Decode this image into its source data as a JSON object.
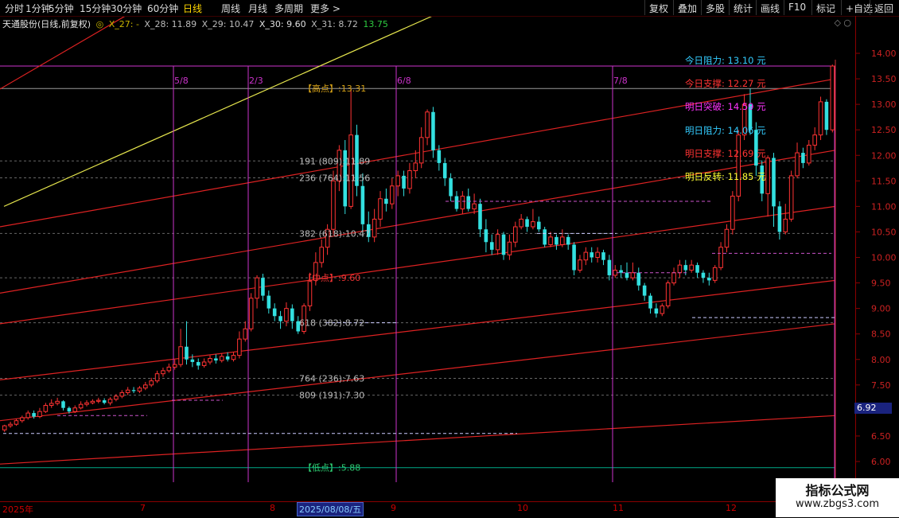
{
  "toolbar": {
    "periods": [
      "分时",
      "1分钟",
      "5分钟",
      "15分钟",
      "30分钟",
      "60分钟",
      "日线",
      "周线",
      "月线",
      "多周期",
      "更多 >"
    ],
    "active_index": 6,
    "right_buttons": [
      "复权",
      "叠加",
      "多股",
      "统计",
      "画线",
      "F10",
      "标记",
      "+自选",
      "返回"
    ]
  },
  "title": {
    "name": "天通股份(日线,前复权)",
    "dot": "◎",
    "x27": "X_27: -",
    "x28": "X_28: 11.89",
    "x29": "X_29: 10.47",
    "x30": "X_30: 9.60",
    "x31": "X_31: 8.72",
    "last": "13.75"
  },
  "corner_icons": "◇ ○",
  "y_axis": [
    "14.00",
    "13.50",
    "13.00",
    "12.50",
    "12.00",
    "11.50",
    "11.00",
    "10.50",
    "10.00",
    "9.50",
    "9.00",
    "8.50",
    "8.00",
    "7.50",
    "7.00",
    "6.50",
    "6.00"
  ],
  "current_price_tag": "6.92",
  "x_axis": {
    "labels": [
      "2025年",
      "7",
      "8",
      "9",
      "10",
      "11",
      "12"
    ],
    "selected_date": "2025/08/08/五"
  },
  "annotations": {
    "high": "【高点】:13.31",
    "mid": "【中点】:9.60",
    "low": "【低点】:5.88",
    "fib191": "191 (809):11.89",
    "fib236": "236 (764):11.56",
    "fib382": "382 (618):10.47",
    "fib618": "618 (382):8.72",
    "fib764": "764 (236):7.63",
    "fib809": "809 (191):7.30"
  },
  "cycle_labels": [
    "5/8",
    "2/3",
    "6/8",
    "7/8"
  ],
  "levels": [
    {
      "label": "今日阻力: 13.10 元",
      "color": "#33ccff"
    },
    {
      "label": "今日支撑: 12.27 元",
      "color": "#ff3333"
    },
    {
      "label": "明日突破: 14.59 元",
      "color": "#ff33ff"
    },
    {
      "label": "明日阻力: 14.06 元",
      "color": "#33ccff"
    },
    {
      "label": "明日支撑: 12.69 元",
      "color": "#ff3333"
    },
    {
      "label": "明日反转: 11.85 元",
      "color": "#ffff33"
    }
  ],
  "watermark": {
    "line1": "指标公式网",
    "line2": "www.zbgs3.com"
  },
  "colors": {
    "up": "#ff3333",
    "down": "#33e0e0",
    "axis": "#8b0000",
    "fib_line": "#666666",
    "cycle": "#cc33cc"
  },
  "chart_data": {
    "type": "candlestick",
    "y_range": [
      5.7,
      14.2
    ],
    "candles": [
      [
        6.62,
        6.7,
        6.72,
        6.58
      ],
      [
        6.7,
        6.73,
        6.78,
        6.66
      ],
      [
        6.73,
        6.8,
        6.84,
        6.7
      ],
      [
        6.8,
        6.86,
        6.9,
        6.76
      ],
      [
        6.86,
        6.95,
        7.0,
        6.82
      ],
      [
        6.95,
        6.88,
        7.0,
        6.84
      ],
      [
        6.88,
        6.98,
        7.05,
        6.85
      ],
      [
        6.98,
        7.1,
        7.15,
        6.95
      ],
      [
        7.1,
        7.14,
        7.22,
        7.05
      ],
      [
        7.14,
        7.18,
        7.25,
        7.1
      ],
      [
        7.18,
        7.05,
        7.2,
        7.0
      ],
      [
        7.05,
        6.98,
        7.08,
        6.94
      ],
      [
        6.98,
        7.05,
        7.1,
        6.95
      ],
      [
        7.05,
        7.12,
        7.18,
        7.02
      ],
      [
        7.12,
        7.15,
        7.2,
        7.08
      ],
      [
        7.15,
        7.18,
        7.22,
        7.12
      ],
      [
        7.18,
        7.2,
        7.25,
        7.14
      ],
      [
        7.2,
        7.15,
        7.24,
        7.12
      ],
      [
        7.15,
        7.22,
        7.26,
        7.1
      ],
      [
        7.22,
        7.28,
        7.32,
        7.18
      ],
      [
        7.28,
        7.35,
        7.4,
        7.24
      ],
      [
        7.35,
        7.4,
        7.46,
        7.3
      ],
      [
        7.4,
        7.38,
        7.46,
        7.34
      ],
      [
        7.38,
        7.44,
        7.48,
        7.34
      ],
      [
        7.44,
        7.5,
        7.56,
        7.4
      ],
      [
        7.5,
        7.58,
        7.64,
        7.46
      ],
      [
        7.58,
        7.72,
        7.78,
        7.54
      ],
      [
        7.72,
        7.78,
        7.84,
        7.66
      ],
      [
        7.78,
        7.85,
        7.92,
        7.74
      ],
      [
        7.85,
        7.9,
        8.0,
        7.8
      ],
      [
        7.9,
        8.25,
        8.6,
        7.85
      ],
      [
        8.25,
        8.0,
        8.75,
        7.9
      ],
      [
        8.0,
        7.95,
        8.1,
        7.85
      ],
      [
        7.95,
        7.88,
        8.02,
        7.8
      ],
      [
        7.88,
        7.95,
        8.02,
        7.84
      ],
      [
        7.95,
        8.02,
        8.08,
        7.9
      ],
      [
        8.02,
        7.98,
        8.1,
        7.92
      ],
      [
        7.98,
        8.06,
        8.12,
        7.94
      ],
      [
        8.06,
        8.0,
        8.14,
        7.96
      ],
      [
        8.0,
        8.08,
        8.14,
        7.96
      ],
      [
        8.08,
        8.4,
        8.55,
        8.02
      ],
      [
        8.4,
        8.6,
        8.75,
        8.35
      ],
      [
        8.6,
        9.2,
        9.3,
        8.55
      ],
      [
        9.2,
        9.6,
        9.65,
        9.0
      ],
      [
        9.6,
        9.25,
        9.68,
        9.15
      ],
      [
        9.25,
        9.0,
        9.35,
        8.9
      ],
      [
        9.0,
        8.85,
        9.1,
        8.75
      ],
      [
        8.85,
        8.75,
        8.95,
        8.6
      ],
      [
        8.75,
        9.0,
        9.12,
        8.65
      ],
      [
        9.0,
        8.75,
        9.08,
        8.6
      ],
      [
        8.75,
        8.55,
        8.85,
        8.5
      ],
      [
        8.55,
        9.05,
        9.1,
        8.5
      ],
      [
        9.05,
        9.55,
        9.7,
        8.95
      ],
      [
        9.55,
        9.9,
        10.1,
        9.45
      ],
      [
        9.9,
        10.2,
        10.35,
        9.8
      ],
      [
        10.2,
        10.55,
        10.65,
        10.05
      ],
      [
        10.55,
        11.5,
        11.7,
        10.45
      ],
      [
        11.5,
        12.1,
        12.2,
        11.3
      ],
      [
        12.1,
        11.0,
        12.3,
        10.85
      ],
      [
        11.0,
        12.4,
        13.31,
        10.95
      ],
      [
        12.4,
        11.4,
        12.6,
        11.2
      ],
      [
        11.4,
        10.65,
        11.65,
        10.4
      ],
      [
        10.65,
        10.4,
        10.9,
        10.3
      ],
      [
        10.4,
        10.75,
        10.95,
        10.3
      ],
      [
        10.75,
        11.15,
        11.3,
        10.6
      ],
      [
        11.15,
        11.05,
        11.35,
        10.9
      ],
      [
        11.05,
        11.4,
        11.55,
        10.95
      ],
      [
        11.4,
        11.6,
        11.7,
        11.2
      ],
      [
        11.6,
        11.35,
        11.7,
        11.2
      ],
      [
        11.35,
        11.7,
        11.85,
        11.25
      ],
      [
        11.7,
        11.85,
        12.1,
        11.55
      ],
      [
        11.85,
        12.35,
        12.55,
        11.75
      ],
      [
        12.35,
        12.85,
        12.9,
        12.2
      ],
      [
        12.85,
        12.1,
        12.95,
        11.95
      ],
      [
        12.1,
        11.85,
        12.2,
        11.7
      ],
      [
        11.85,
        11.55,
        11.95,
        11.4
      ],
      [
        11.55,
        11.2,
        11.65,
        11.1
      ],
      [
        11.2,
        10.95,
        11.3,
        10.9
      ],
      [
        10.95,
        11.2,
        11.3,
        10.85
      ],
      [
        11.2,
        10.95,
        11.35,
        10.9
      ],
      [
        10.95,
        11.05,
        11.25,
        10.85
      ],
      [
        11.05,
        10.55,
        11.15,
        10.4
      ],
      [
        10.55,
        10.3,
        10.75,
        10.1
      ],
      [
        10.3,
        10.15,
        10.45,
        10.05
      ],
      [
        10.15,
        10.45,
        10.55,
        10.05
      ],
      [
        10.45,
        10.05,
        10.5,
        9.95
      ],
      [
        10.05,
        10.3,
        10.45,
        9.95
      ],
      [
        10.3,
        10.6,
        10.7,
        10.2
      ],
      [
        10.6,
        10.75,
        10.85,
        10.55
      ],
      [
        10.75,
        10.6,
        10.8,
        10.5
      ],
      [
        10.6,
        10.7,
        10.95,
        10.55
      ],
      [
        10.7,
        10.55,
        10.8,
        10.5
      ],
      [
        10.55,
        10.25,
        10.6,
        10.2
      ],
      [
        10.25,
        10.4,
        10.5,
        10.2
      ],
      [
        10.4,
        10.25,
        10.45,
        10.15
      ],
      [
        10.25,
        10.4,
        10.55,
        10.2
      ],
      [
        10.4,
        10.25,
        10.45,
        10.15
      ],
      [
        10.25,
        9.75,
        10.3,
        9.65
      ],
      [
        9.75,
        9.95,
        10.05,
        9.7
      ],
      [
        9.95,
        10.1,
        10.2,
        9.85
      ],
      [
        10.1,
        10.0,
        10.2,
        9.9
      ],
      [
        10.0,
        10.1,
        10.2,
        9.9
      ],
      [
        10.1,
        9.95,
        10.15,
        9.85
      ],
      [
        9.95,
        9.65,
        10.05,
        9.55
      ],
      [
        9.65,
        9.75,
        9.85,
        9.6
      ],
      [
        9.75,
        9.7,
        9.85,
        9.6
      ],
      [
        9.7,
        9.6,
        9.9,
        9.55
      ],
      [
        9.6,
        9.7,
        9.9,
        9.55
      ],
      [
        9.7,
        9.45,
        9.8,
        9.35
      ],
      [
        9.45,
        9.25,
        9.5,
        9.15
      ],
      [
        9.25,
        9.0,
        9.3,
        8.9
      ],
      [
        9.0,
        8.9,
        9.1,
        8.82
      ],
      [
        8.9,
        9.05,
        9.1,
        8.85
      ],
      [
        9.05,
        9.5,
        9.55,
        9.0
      ],
      [
        9.5,
        9.7,
        9.8,
        9.45
      ],
      [
        9.7,
        9.85,
        9.95,
        9.6
      ],
      [
        9.85,
        9.75,
        9.95,
        9.65
      ],
      [
        9.75,
        9.85,
        9.95,
        9.7
      ],
      [
        9.85,
        9.7,
        9.9,
        9.6
      ],
      [
        9.7,
        9.6,
        9.75,
        9.5
      ],
      [
        9.6,
        9.55,
        9.7,
        9.45
      ],
      [
        9.55,
        9.8,
        9.85,
        9.5
      ],
      [
        9.8,
        10.2,
        10.3,
        9.75
      ],
      [
        10.2,
        10.55,
        10.65,
        10.1
      ],
      [
        10.55,
        11.2,
        11.3,
        10.45
      ],
      [
        11.2,
        12.4,
        12.5,
        11.1
      ],
      [
        12.4,
        13.0,
        13.2,
        12.3
      ],
      [
        13.0,
        12.5,
        13.31,
        12.4
      ],
      [
        12.5,
        11.8,
        12.65,
        11.6
      ],
      [
        11.8,
        11.25,
        11.9,
        11.1
      ],
      [
        11.25,
        11.95,
        12.0,
        10.8
      ],
      [
        11.95,
        11.0,
        12.05,
        10.6
      ],
      [
        11.0,
        10.5,
        11.1,
        10.35
      ],
      [
        10.5,
        10.75,
        11.05,
        10.45
      ],
      [
        10.75,
        11.6,
        11.7,
        10.7
      ],
      [
        11.6,
        12.05,
        12.25,
        11.55
      ],
      [
        12.05,
        11.85,
        12.15,
        11.75
      ],
      [
        11.85,
        12.2,
        12.3,
        11.8
      ],
      [
        12.2,
        12.4,
        12.55,
        12.1
      ],
      [
        12.4,
        13.05,
        13.15,
        12.3
      ],
      [
        13.05,
        12.5,
        13.1,
        12.4
      ],
      [
        12.5,
        13.75,
        13.78,
        12.45
      ]
    ]
  }
}
